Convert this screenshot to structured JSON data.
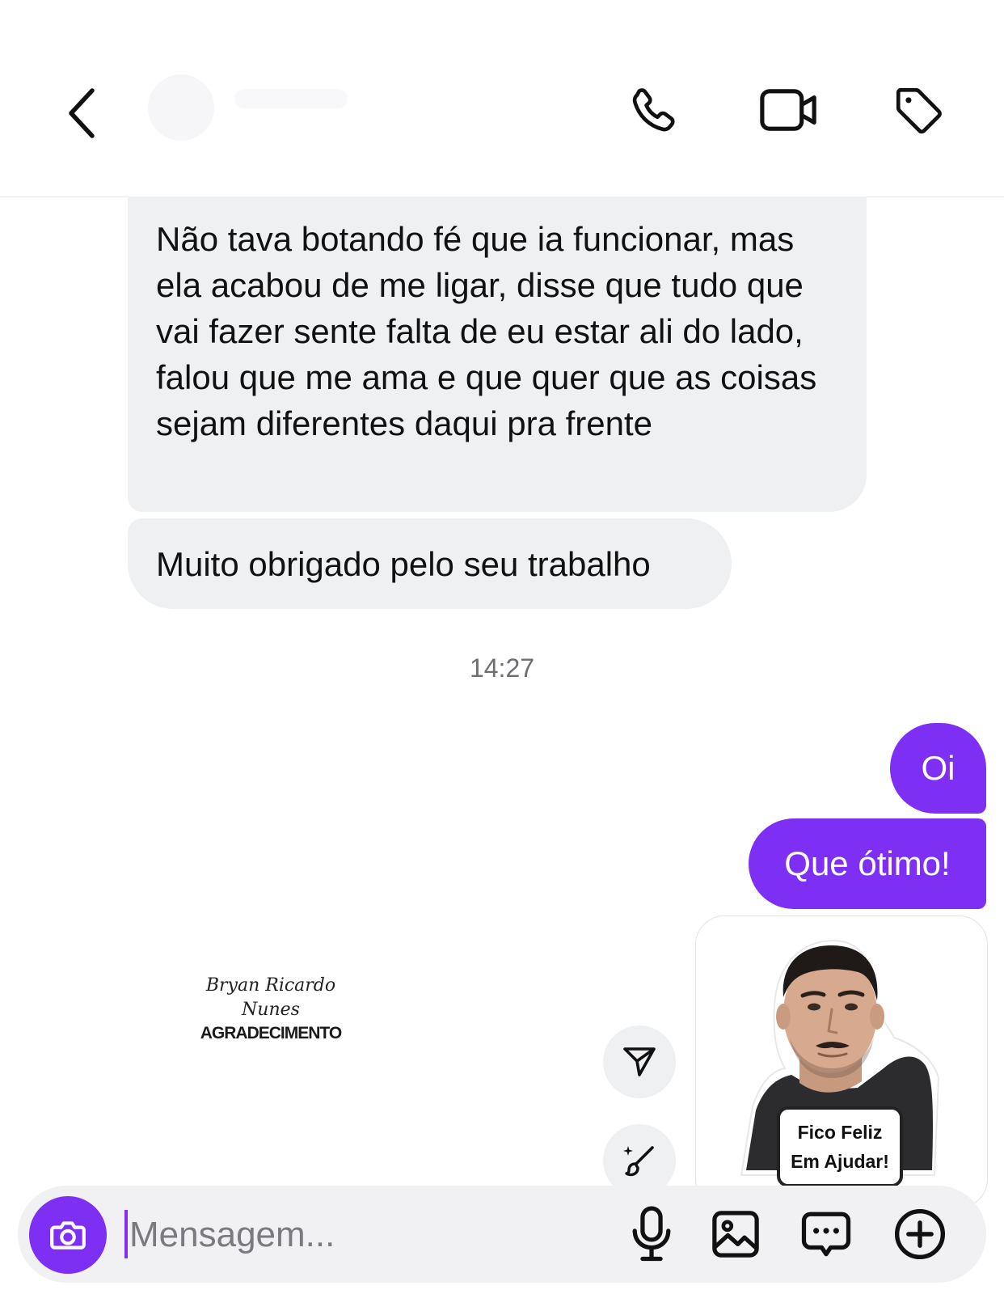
{
  "header": {
    "back_icon": "chevron-left-icon",
    "actions": [
      "phone-icon",
      "video-camera-icon",
      "tag-icon"
    ]
  },
  "messages": {
    "incoming": [
      "Não tava botando fé que ia funcionar, mas ela acabou de me ligar, disse que tudo que vai fazer sente falta de eu estar ali do lado, falou que me ama e que quer que as coisas sejam diferentes daqui pra frente",
      "Muito obrigado pelo seu trabalho"
    ],
    "timestamp": "14:27",
    "outgoing": [
      "Oi",
      "Que ótimo!"
    ],
    "sticker": {
      "caption_line1": "Fico Feliz",
      "caption_line2": "Em Ajudar!"
    }
  },
  "watermark": {
    "line1": "Bryan Ricardo",
    "line2": "Nunes",
    "line3": "AGRADECIMENTO"
  },
  "composer": {
    "placeholder": "Mensagem...",
    "icons": [
      "camera-icon",
      "microphone-icon",
      "image-icon",
      "sticker-icon",
      "plus-icon"
    ]
  },
  "colors": {
    "accent": "#7e2ff4",
    "incoming_bubble": "#eff0f2",
    "timestamp": "#6d6d72"
  }
}
